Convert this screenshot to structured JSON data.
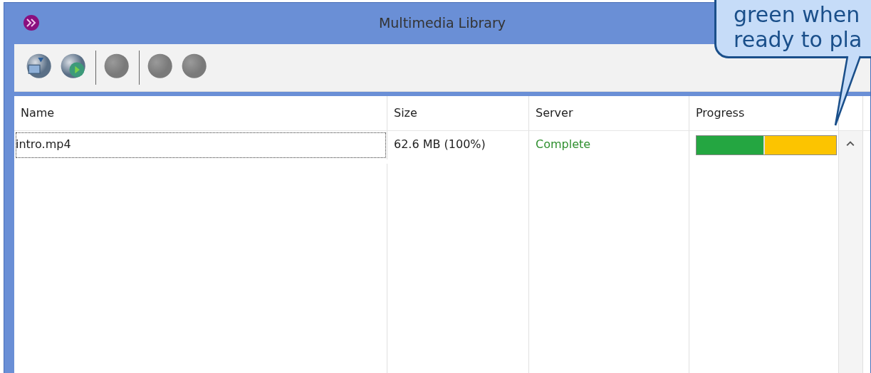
{
  "window": {
    "title": "Multimedia Library"
  },
  "toolbar": [
    {
      "kind": "button",
      "disabled": false
    },
    {
      "kind": "button",
      "disabled": false
    },
    {
      "kind": "separator"
    },
    {
      "kind": "button",
      "disabled": true
    },
    {
      "kind": "separator"
    },
    {
      "kind": "button",
      "disabled": true
    },
    {
      "kind": "button",
      "disabled": true
    }
  ],
  "table": {
    "columns": [
      "Name",
      "Size",
      "Server",
      "Progress"
    ],
    "rows": [
      {
        "name": "intro.mp4",
        "size": "62.6 MB (100%)",
        "server": "Complete",
        "focused": true,
        "level": 0.49
      }
    ]
  },
  "callout": {
    "lines": [
      "green when",
      "ready to pla"
    ]
  }
}
